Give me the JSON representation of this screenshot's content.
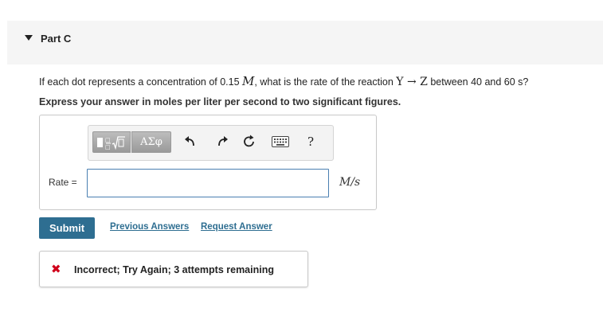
{
  "part": {
    "title": "Part C"
  },
  "question": {
    "prefix": "If each dot represents a concentration of 0.15 ",
    "unit_symbol": "M",
    "middle": ", what is the rate of the reaction ",
    "reaction": "Y → Z",
    "suffix": " between 40 and 60 s?"
  },
  "instruction": "Express your answer in moles per liter per second to two significant figures.",
  "toolbar": {
    "templates_icon": "templates-sqrt-icon",
    "greek_label": "ΑΣφ",
    "undo_icon": "undo-icon",
    "redo_icon": "redo-icon",
    "reset_icon": "reset-icon",
    "keyboard_icon": "keyboard-icon",
    "help_label": "?"
  },
  "answer": {
    "label": "Rate =",
    "value": "",
    "unit": "M/s"
  },
  "actions": {
    "submit_label": "Submit",
    "previous_answers_label": "Previous Answers",
    "request_answer_label": "Request Answer"
  },
  "feedback": {
    "icon": "incorrect-x-icon",
    "text": "Incorrect; Try Again; 3 attempts remaining",
    "color": "#d0021b"
  },
  "colors": {
    "accent": "#2e6e91",
    "input_border": "#4a7fb1",
    "header_bg": "#f5f5f5"
  }
}
